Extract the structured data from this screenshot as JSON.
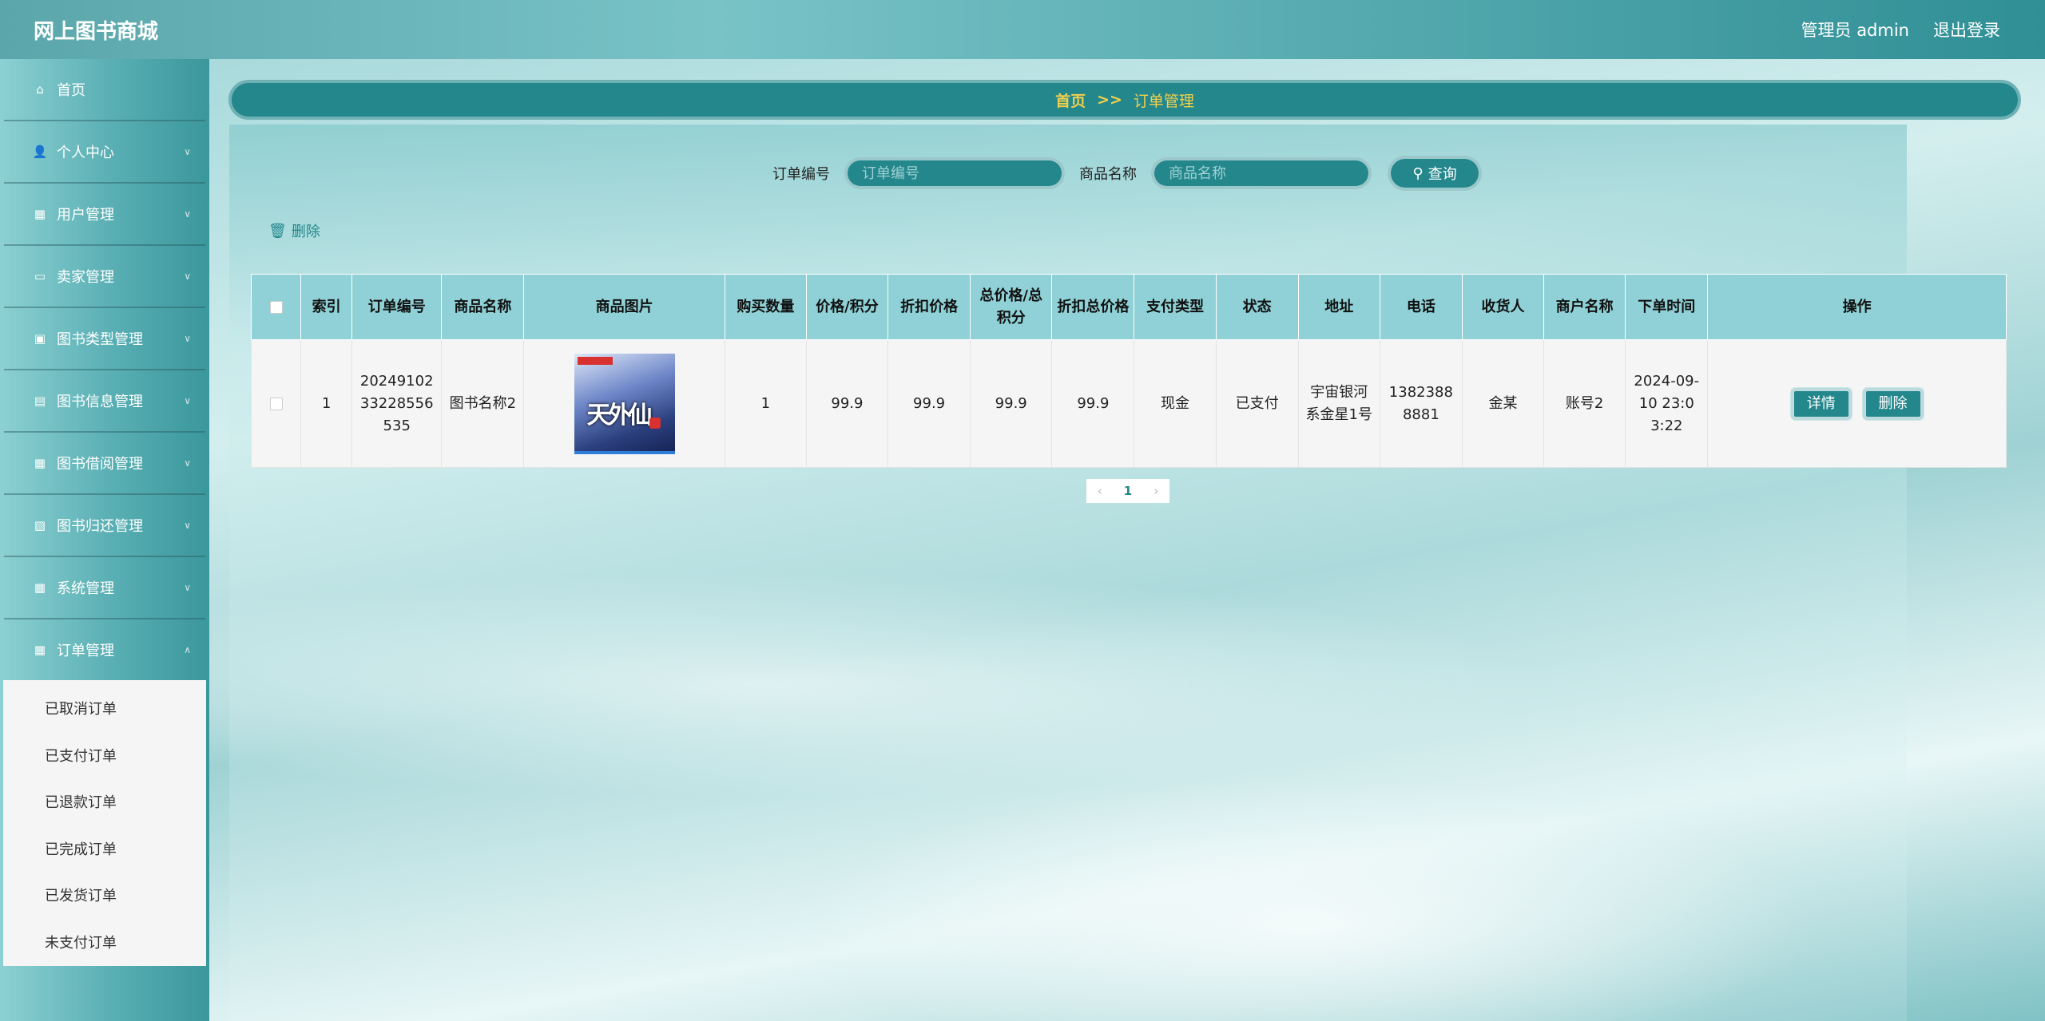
{
  "header": {
    "title": "网上图书商城",
    "user": "管理员 admin",
    "logout": "退出登录"
  },
  "sidebar": {
    "items": [
      {
        "label": "首页",
        "icon": "home-icon"
      },
      {
        "label": "个人中心",
        "icon": "user-icon"
      },
      {
        "label": "用户管理",
        "icon": "grid-icon"
      },
      {
        "label": "卖家管理",
        "icon": "ticket-icon"
      },
      {
        "label": "图书类型管理",
        "icon": "briefcase-icon"
      },
      {
        "label": "图书信息管理",
        "icon": "printer-icon"
      },
      {
        "label": "图书借阅管理",
        "icon": "grid-icon"
      },
      {
        "label": "图书归还管理",
        "icon": "clipboard-icon"
      },
      {
        "label": "系统管理",
        "icon": "grid-icon"
      },
      {
        "label": "订单管理",
        "icon": "grid-icon"
      }
    ],
    "submenu": [
      "已取消订单",
      "已支付订单",
      "已退款订单",
      "已完成订单",
      "已发货订单",
      "未支付订单"
    ]
  },
  "breadcrumb": {
    "home": "首页",
    "sep": ">>",
    "current": "订单管理"
  },
  "search": {
    "order_label": "订单编号",
    "order_placeholder": "订单编号",
    "goods_label": "商品名称",
    "goods_placeholder": "商品名称",
    "button": "查询"
  },
  "actions": {
    "delete": "删除"
  },
  "table": {
    "headers": [
      "索引",
      "订单编号",
      "商品名称",
      "商品图片",
      "购买数量",
      "价格/积分",
      "折扣价格",
      "总价格/总积分",
      "折扣总价格",
      "支付类型",
      "状态",
      "地址",
      "电话",
      "收货人",
      "商户名称",
      "下单时间",
      "操作"
    ],
    "rows": [
      {
        "index": "1",
        "order_no": "2024910233228556535",
        "goods_name": "图书名称2",
        "image_title": "天外仙",
        "quantity": "1",
        "price": "99.9",
        "discount_price": "99.9",
        "total": "99.9",
        "discount_total": "99.9",
        "pay_type": "现金",
        "status": "已支付",
        "address": "宇宙银河系金星1号",
        "phone": "13823888881",
        "receiver": "金某",
        "merchant": "账号2",
        "time": "2024-09-10 23:03:22",
        "detail_btn": "详情",
        "delete_btn": "删除"
      }
    ]
  },
  "pagination": {
    "prev": "‹",
    "current": "1",
    "next": "›"
  }
}
